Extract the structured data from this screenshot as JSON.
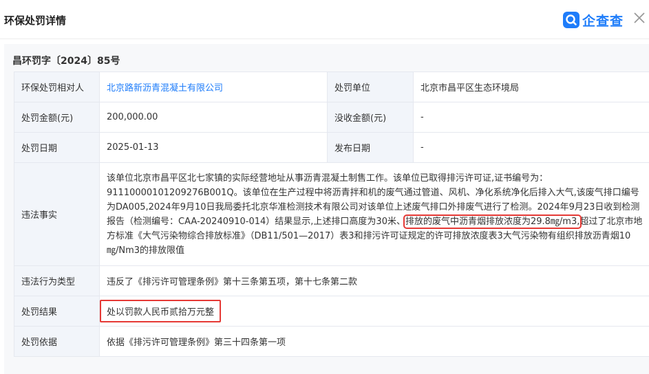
{
  "header": {
    "title": "环保处罚详情",
    "brand_name": "企查查",
    "brand_color": "#1f7dfa"
  },
  "case_no": "昌环罚字〔2024〕85号",
  "rows": {
    "party_label": "环保处罚相对人",
    "party_value": "北京路新沥青混凝土有限公司",
    "unit_label": "处罚单位",
    "unit_value": "北京市昌平区生态环境局",
    "amount_label": "处罚金额(元)",
    "amount_value": "200,000.00",
    "confiscate_label": "没收金额(元)",
    "confiscate_value": "-",
    "date_label": "处罚日期",
    "date_value": "2025-01-13",
    "publish_label": "发布日期",
    "publish_value": "-",
    "facts_label": "违法事实",
    "facts_part1": "该单位北京市昌平区北七家镇的实际经营地址从事沥青混凝土制售工作。该单位已取得排污许可证,证书编号为：91110000101209276B001Q。该单位在生产过程中将沥青拌和机的废气通过管道、风机、净化系统净化后排入大气,该废气排口编号为DA005,2024年9月10日我局委托北京华准检测技术有限公司对该单位上述废气排口外排废气进行了检测。2024年9月23日收到检测报告（检测编号：CAA-20240910-014）结果显示,上述排口高度为30米、",
    "facts_highlight": "排放的废气中沥青烟排放浓度为29.8㎎/m3,",
    "facts_part2": "超过了北京市地方标准《大气污染物综合排放标准》（DB11/501—2017）表3和排污许可证规定的许可排放浓度表3大气污染物有组织排放沥青烟10㎎/Nm3的排放限值",
    "type_label": "违法行为类型",
    "type_value": "违反了《排污许可管理条例》第十三条第五项，第十七条第二款",
    "result_label": "处罚结果",
    "result_value": "处以罚款人民币贰拾万元整",
    "basis_label": "处罚依据",
    "basis_value": "依据《排污许可管理条例》第三十四条第一项"
  },
  "highlight_color": "#e53935"
}
